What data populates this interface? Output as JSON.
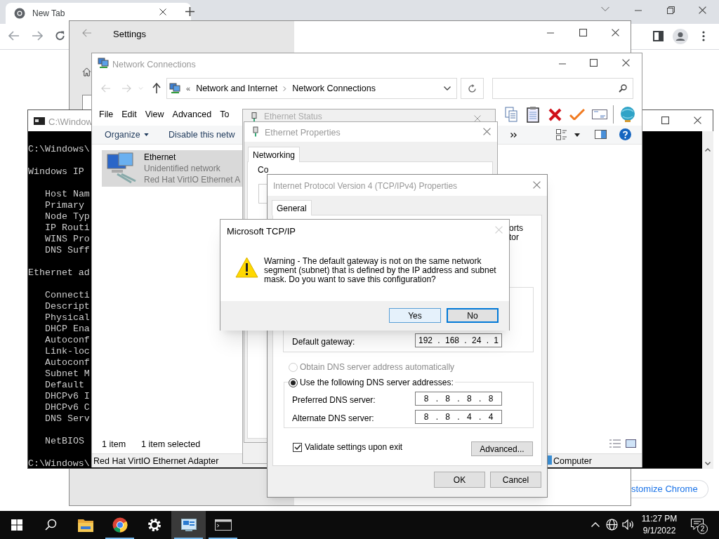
{
  "browser": {
    "tab": {
      "label": "New Tab",
      "selected": true
    },
    "customize_button": "stomize Chrome"
  },
  "settings": {
    "title": "Settings"
  },
  "network_connections": {
    "title": "Network Connections",
    "overflow_glyph": "«",
    "breadcrumb": [
      "Network and Internet",
      "Network Connections"
    ],
    "menu": [
      "File",
      "Edit",
      "View",
      "Advanced",
      "To"
    ],
    "commands": [
      "Organize",
      "Disable this netw"
    ],
    "items": [
      {
        "name": "Ethernet",
        "status": "Unidentified network",
        "device": "Red Hat VirtIO Ethernet A",
        "selected": true
      }
    ],
    "status_bar": [
      "1 item",
      "1 item selected"
    ],
    "details_bar": "Red Hat VirtIO Ethernet Adapter",
    "location": "Computer"
  },
  "console": {
    "title": "C:\\Window",
    "blocks": [
      {
        "kind": "plain",
        "lines": [
          "C:\\Windows\\"
        ]
      },
      {
        "kind": "plain",
        "lines": [
          "Windows IP"
        ]
      },
      {
        "kind": "indented",
        "lines": [
          "Host Nam",
          "Primary",
          "Node Typ",
          "IP Routi",
          "WINS Pro",
          "DNS Suff"
        ]
      },
      {
        "kind": "plain",
        "lines": [
          "Ethernet ad"
        ]
      },
      {
        "kind": "indented",
        "lines": [
          "Connecti",
          "Descript",
          "Physical",
          "DHCP Ena",
          "Autoconf",
          "Link-loc",
          "Autoconf",
          "Subnet M",
          "Default",
          "DHCPv6 I",
          "DHCPv6 C",
          "DNS Serv"
        ]
      },
      {
        "kind": "indented",
        "lines": [
          "NetBIOS"
        ]
      },
      {
        "kind": "plain",
        "lines": [
          "C:\\Windows\\"
        ]
      }
    ]
  },
  "ethernet_status": {
    "title": "Ethernet Status"
  },
  "ethernet_properties": {
    "title": "Ethernet Properties",
    "tabs": [
      {
        "label": "Networking",
        "selected": true
      }
    ],
    "label": "Co"
  },
  "ipv4_properties": {
    "title": "Internet Protocol Version 4 (TCP/IPv4) Properties",
    "tabs": [
      {
        "label": "General",
        "selected": true
      }
    ],
    "partial_text": [
      "orts",
      "tor"
    ],
    "gateway": {
      "label": "Default gateway:",
      "value": "192 . 168 . 24 . 1"
    },
    "dns_options": [
      {
        "label": "Obtain DNS server address automatically",
        "selected": false,
        "disabled": true
      },
      {
        "label": "Use the following DNS server addresses:",
        "selected": true,
        "disabled": false
      }
    ],
    "dns_servers": [
      {
        "label": "Preferred DNS server:",
        "value": "8 . 8 . 8 . 8"
      },
      {
        "label": "Alternate DNS server:",
        "value": "8 . 8 . 4 . 4"
      }
    ],
    "validate": {
      "label": "Validate settings upon exit",
      "checked": true
    },
    "buttons": [
      "Advanced...",
      "OK",
      "Cancel"
    ]
  },
  "message_box": {
    "title": "Microsoft TCP/IP",
    "message": [
      "Warning - The default gateway is not on the same network",
      "segment (subnet) that is defined by the IP address and subnet",
      "mask. Do you want to save this configuration?"
    ],
    "buttons": [
      {
        "label": "Yes",
        "default": false
      },
      {
        "label": "No",
        "default": true
      }
    ]
  },
  "taskbar": {
    "apps": [
      {
        "kind": "explorer",
        "selected": false,
        "running": false
      },
      {
        "kind": "browser",
        "selected": false,
        "running": true
      },
      {
        "kind": "settings",
        "selected": false,
        "running": false
      },
      {
        "kind": "network",
        "selected": true,
        "running": true
      },
      {
        "kind": "console",
        "selected": false,
        "running": true
      }
    ],
    "time": "11:27 PM",
    "date": "9/1/2022",
    "notifications": "2"
  }
}
